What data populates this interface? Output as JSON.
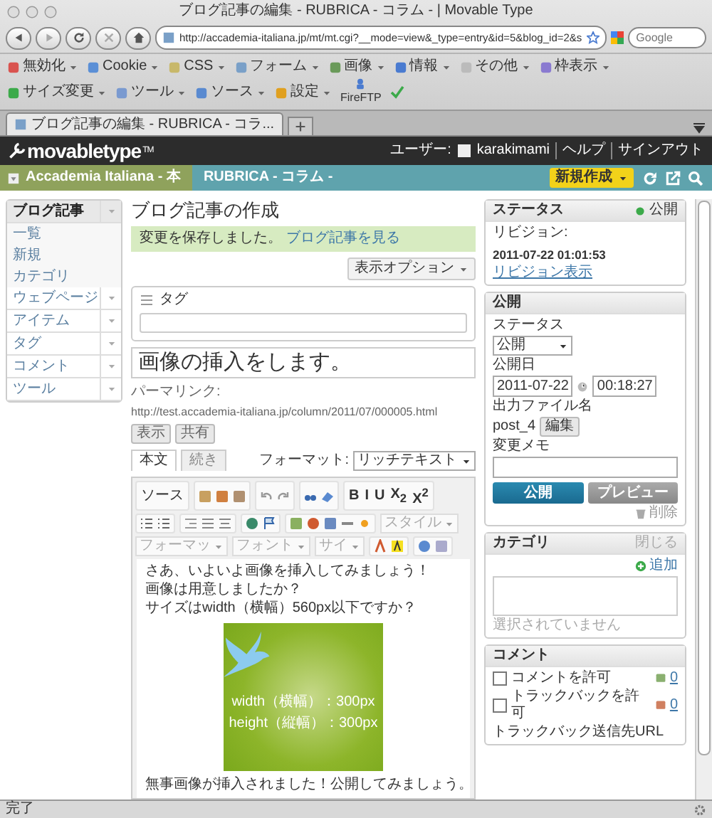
{
  "browser": {
    "title": "ブログ記事の編集 - RUBRICA - コラム - | Movable Type",
    "url": "http://accademia-italiana.jp/mt/mt.cgi?__mode=view&_type=entry&id=5&blog_id=2&s",
    "search": {
      "placeholder": "Google"
    },
    "bookmarks": [
      "無効化",
      "Cookie",
      "CSS",
      "フォーム",
      "画像",
      "情報",
      "その他",
      "枠表示",
      "サイズ変更",
      "ツール",
      "ソース",
      "設定"
    ],
    "ftp": "FireFTP",
    "tabs": [
      {
        "label": "ブログ記事の編集 - RUBRICA - コラ...",
        "selected": true
      }
    ]
  },
  "header": {
    "logo": "movabletype",
    "logo_mark": "TM",
    "user_label": "ユーザー:",
    "user": "karakimami",
    "links": [
      "ヘルプ",
      "サインアウト"
    ]
  },
  "crumbs": {
    "site": "Accademia Italiana - 本",
    "blog": "RUBRICA - コラム -",
    "new": "新規作成"
  },
  "sidebar": [
    {
      "label": "ブログ記事",
      "expanded": true,
      "children": [
        {
          "label": "一覧"
        },
        {
          "label": "新規"
        },
        {
          "label": "カテゴリ"
        }
      ]
    },
    {
      "label": "ウェブページ",
      "expanded": false
    },
    {
      "label": "アイテム",
      "expanded": false
    },
    {
      "label": "タグ",
      "expanded": false
    },
    {
      "label": "コメント",
      "expanded": false
    },
    {
      "label": "ツール",
      "expanded": false
    }
  ],
  "page": {
    "title": "ブログ記事の作成",
    "message": {
      "text": "変更を保存しました。",
      "link": "ブログ記事を見る"
    },
    "display_options": "表示オプション"
  },
  "tags": {
    "label": "タグ"
  },
  "entry_title": "画像の挿入をします。",
  "permalink": {
    "label": "パーマリンク:",
    "url": "http://test.accademia-italiana.jp/column/2011/07/000005.html",
    "buttons": [
      "表示",
      "共有"
    ]
  },
  "editor": {
    "tabs": [
      {
        "label": "本文",
        "selected": true
      },
      {
        "label": "続き",
        "selected": false
      }
    ],
    "format_label": "フォーマット:",
    "format": "リッチテキスト",
    "source_button": "ソース",
    "text_buttons": [
      "B",
      "I",
      "U",
      "X$_{2}$",
      "X$^{2}$"
    ],
    "dropdowns": [
      "スタイル",
      "フォーマッ",
      "フォント",
      "サイ"
    ],
    "body": [
      "さあ、いよいよ画像を挿入してみましょう！",
      "画像は用意しましたか？",
      "サイズはwidth（横幅）560px以下ですか？"
    ],
    "image_lines": [
      "width（横幅）：300px",
      "height（縦幅）：300px"
    ],
    "after": "無事画像が挿入されました！公開してみましょう。"
  },
  "status": {
    "title": "ステータス",
    "state": "公開",
    "revision_label": "リビジョン:",
    "revision": "2011-07-22 01:01:53",
    "revision_link": "リビジョン表示"
  },
  "publish": {
    "title": "公開",
    "status_label": "ステータス",
    "status": "公開",
    "date_label": "公開日",
    "date": "2011-07-22",
    "time": "00:18:27",
    "file_label": "出力ファイル名",
    "file": "post_4",
    "edit": "編集",
    "memo_label": "変更メモ",
    "publish_button": "公開",
    "preview_button": "プレビュー",
    "delete": "削除"
  },
  "category": {
    "title": "カテゴリ",
    "close": "閉じる",
    "add": "追加",
    "empty": "選択されていません"
  },
  "comments": {
    "title": "コメント",
    "options": [
      {
        "label": "コメントを許可",
        "checked": false,
        "count": "0"
      },
      {
        "label": "トラックバックを許可",
        "checked": false,
        "count": "0"
      }
    ],
    "trackback_label": "トラックバック送信先URL"
  },
  "status_bar": "完了"
}
